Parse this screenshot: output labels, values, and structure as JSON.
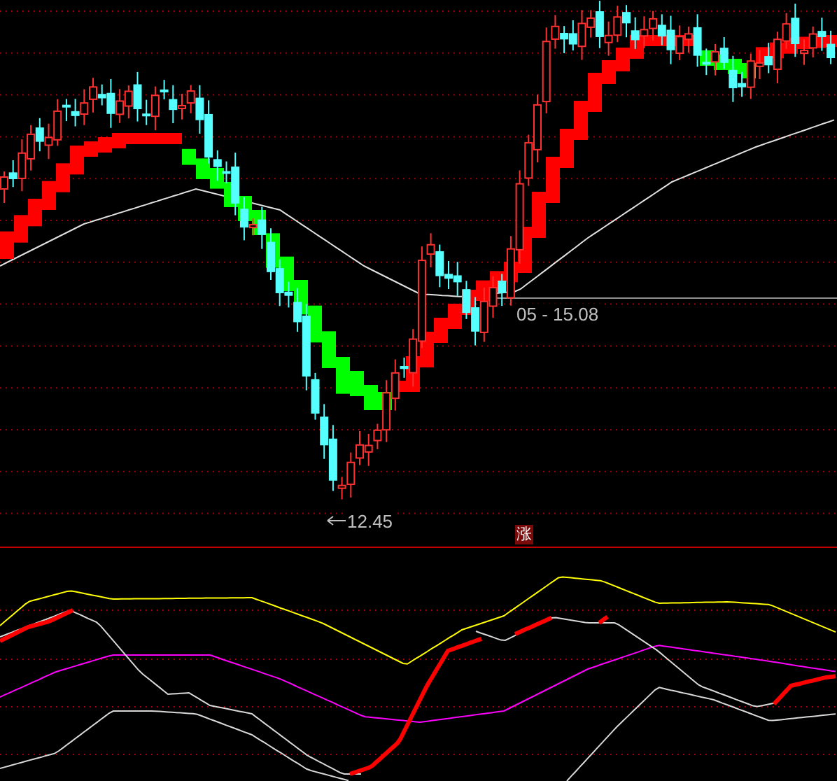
{
  "price_panel": {
    "low_label": "12.45",
    "range_label": "05 - 15.08"
  },
  "signal_marker": {
    "text": "涨"
  }
}
